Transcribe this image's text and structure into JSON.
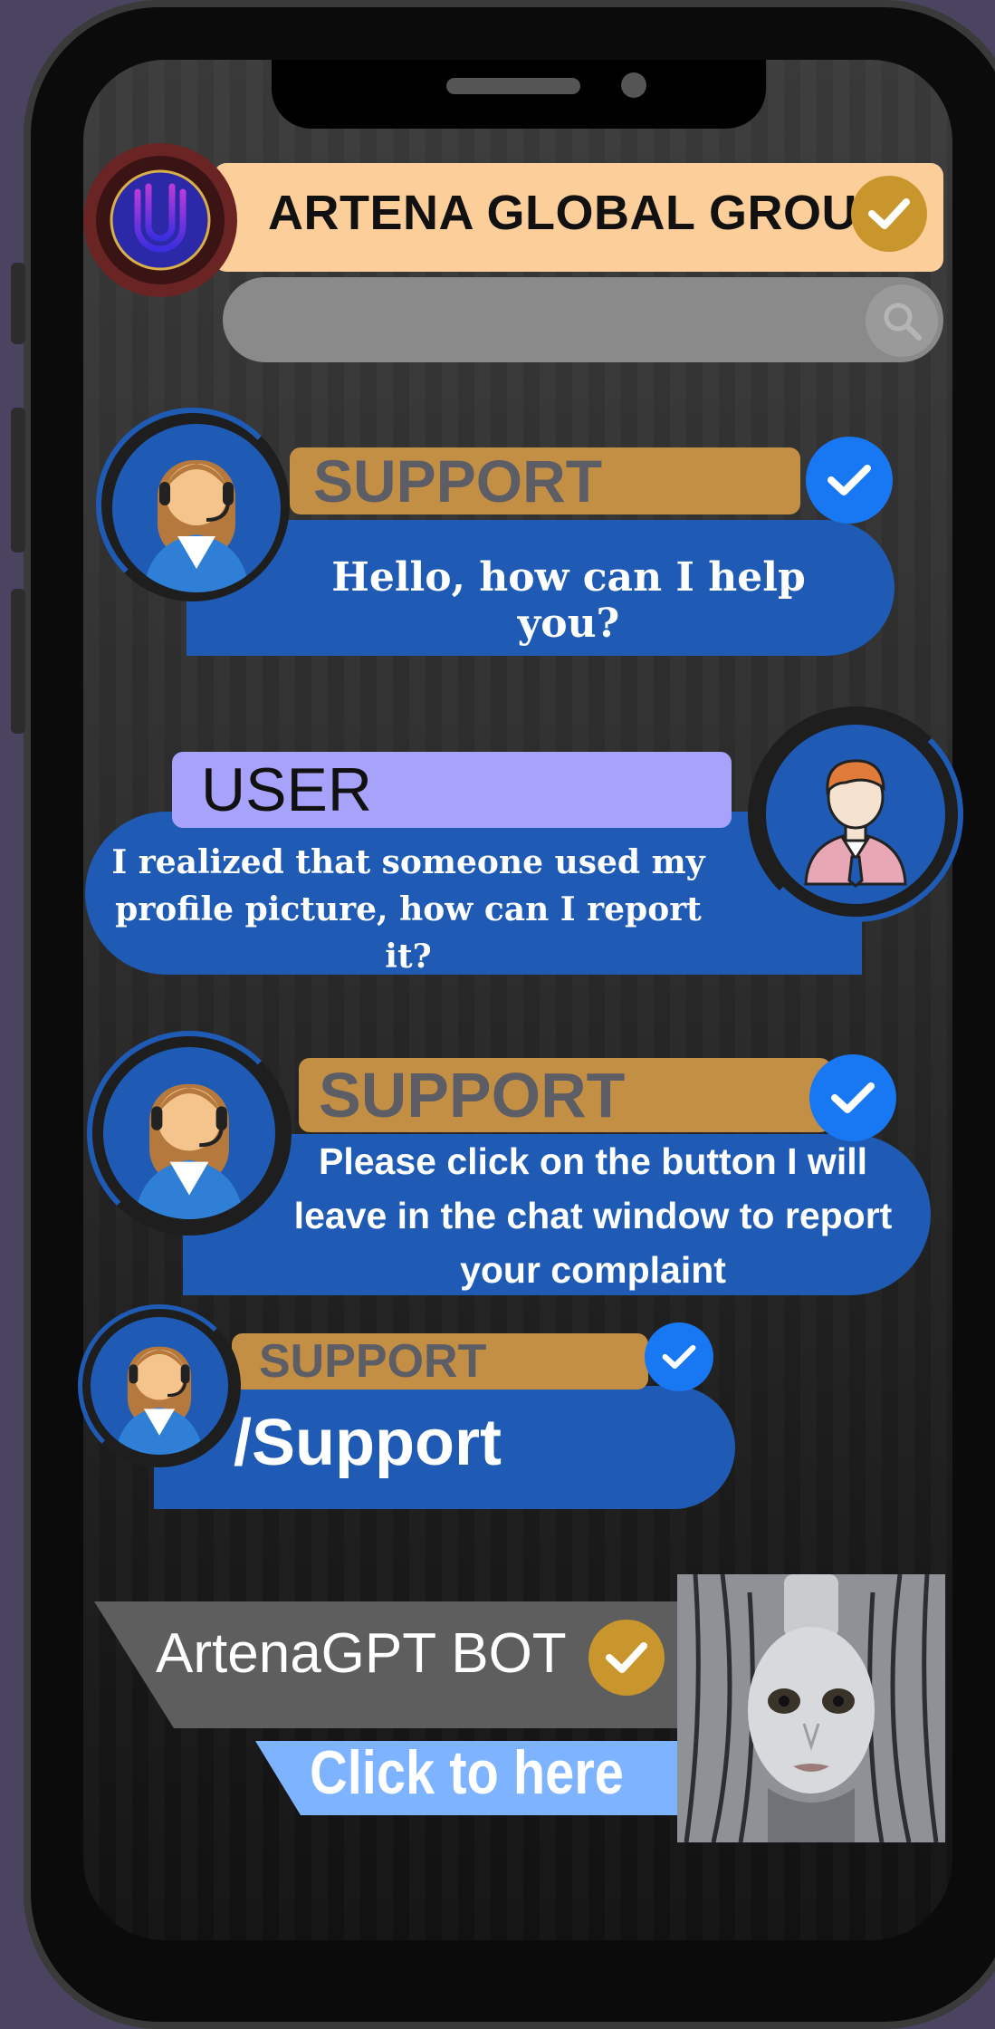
{
  "header": {
    "title": "ARTENA GLOBAL GROUP",
    "verified_icon": "check-badge-icon",
    "logo_icon": "fingerprint-icon"
  },
  "search": {
    "placeholder": "",
    "icon": "search-icon"
  },
  "messages": [
    {
      "sender": "SUPPORT",
      "text": "Hello, how can I help you?"
    },
    {
      "sender": "USER",
      "text": "I realized that someone used my profile picture, how can I report it?"
    },
    {
      "sender": "SUPPORT",
      "text": "Please click on the button I will leave in the chat window to report your complaint"
    },
    {
      "sender": "SUPPORT",
      "text": "/Support"
    }
  ],
  "bot": {
    "name": "ArtenaGPT BOT",
    "button_label": "Click to here",
    "image_icon": "robot-face-image"
  },
  "colors": {
    "header_bg": "#fccf9a",
    "bubble": "#1f5bb4",
    "support_label": "#c38f45",
    "user_label": "#a7a3fb",
    "gold_badge": "#c9952d",
    "blue_badge": "#1877f2",
    "click_button": "#7eb4ff"
  }
}
